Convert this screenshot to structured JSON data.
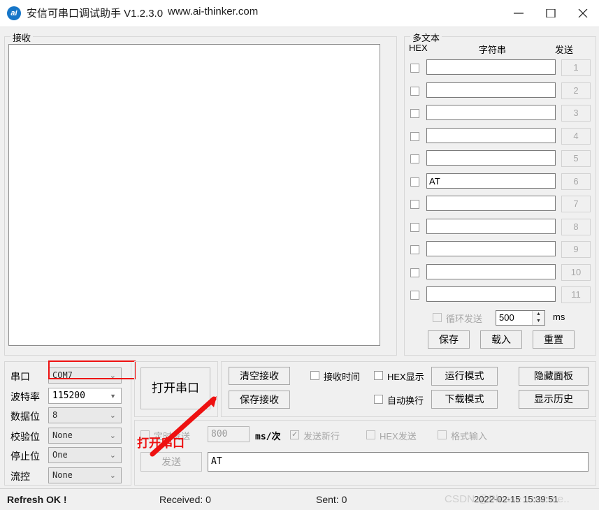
{
  "window": {
    "icon_label": "ai",
    "title": "安信可串口调试助手 V1.2.3.0",
    "url": "www.ai-thinker.com",
    "minimize_icon": "minimize-icon",
    "maximize_icon": "maximize-icon",
    "close_icon": "close-icon"
  },
  "receive": {
    "group_title": "接收",
    "content": "",
    "scroll_up_icon": "chevron-up-icon",
    "scroll_down_icon": "chevron-down-icon"
  },
  "multitext": {
    "group_title": "多文本",
    "headers": {
      "hex": "HEX",
      "string": "字符串",
      "send": "发送"
    },
    "rows": [
      {
        "hex_checked": false,
        "text": "",
        "button": "1"
      },
      {
        "hex_checked": false,
        "text": "",
        "button": "2"
      },
      {
        "hex_checked": false,
        "text": "",
        "button": "3"
      },
      {
        "hex_checked": false,
        "text": "",
        "button": "4"
      },
      {
        "hex_checked": false,
        "text": "",
        "button": "5"
      },
      {
        "hex_checked": false,
        "text": "AT",
        "button": "6"
      },
      {
        "hex_checked": false,
        "text": "",
        "button": "7"
      },
      {
        "hex_checked": false,
        "text": "",
        "button": "8"
      },
      {
        "hex_checked": false,
        "text": "",
        "button": "9"
      },
      {
        "hex_checked": false,
        "text": "",
        "button": "10"
      },
      {
        "hex_checked": false,
        "text": "",
        "button": "11"
      }
    ],
    "cyclic": {
      "label": "循环发送",
      "checked": false,
      "interval": "500",
      "unit": "ms",
      "spin_up_icon": "spinner-up-icon",
      "spin_down_icon": "spinner-down-icon"
    },
    "buttons": {
      "save": "保存",
      "load": "载入",
      "reset": "重置"
    }
  },
  "config": {
    "rows": [
      {
        "label": "串口",
        "value": "COM7"
      },
      {
        "label": "波特率",
        "value": "115200"
      },
      {
        "label": "数据位",
        "value": "8"
      },
      {
        "label": "校验位",
        "value": "None"
      },
      {
        "label": "停止位",
        "value": "One"
      },
      {
        "label": "流控",
        "value": "None"
      }
    ],
    "dropdown_icon": "chevron-down-icon"
  },
  "open_button": {
    "label": "打开串口"
  },
  "operations": {
    "clear_receive": "清空接收",
    "save_receive": "保存接收",
    "run_mode": "运行模式",
    "download_mode": "下载模式",
    "hide_panel": "隐藏面板",
    "show_history": "显示历史",
    "checkboxes": {
      "recv_time": {
        "label": "接收时间",
        "checked": false
      },
      "hex_display": {
        "label": "HEX显示",
        "checked": false
      },
      "auto_wrap": {
        "label": "自动换行",
        "checked": false
      }
    }
  },
  "send": {
    "timed_send": {
      "label": "定时发送",
      "checked": false
    },
    "interval": "800",
    "interval_unit": "ms/次",
    "send_newline": {
      "label": "发送新行",
      "checked": true
    },
    "hex_send": {
      "label": "HEX发送",
      "checked": false
    },
    "format_input": {
      "label": "格式输入",
      "checked": false
    },
    "send_button": "发送",
    "input_value": "AT"
  },
  "status": {
    "refresh": "Refresh OK !",
    "received": "Received: 0",
    "sent": "Sent: 0",
    "timestamp": "2022-02-15 15:39:51",
    "watermark": "CSDN @Please trust me.."
  },
  "annotation": {
    "text": "打开串口",
    "color": "#ee1111",
    "arrow_icon": "red-arrow-icon",
    "highlight_target": "波特率"
  }
}
